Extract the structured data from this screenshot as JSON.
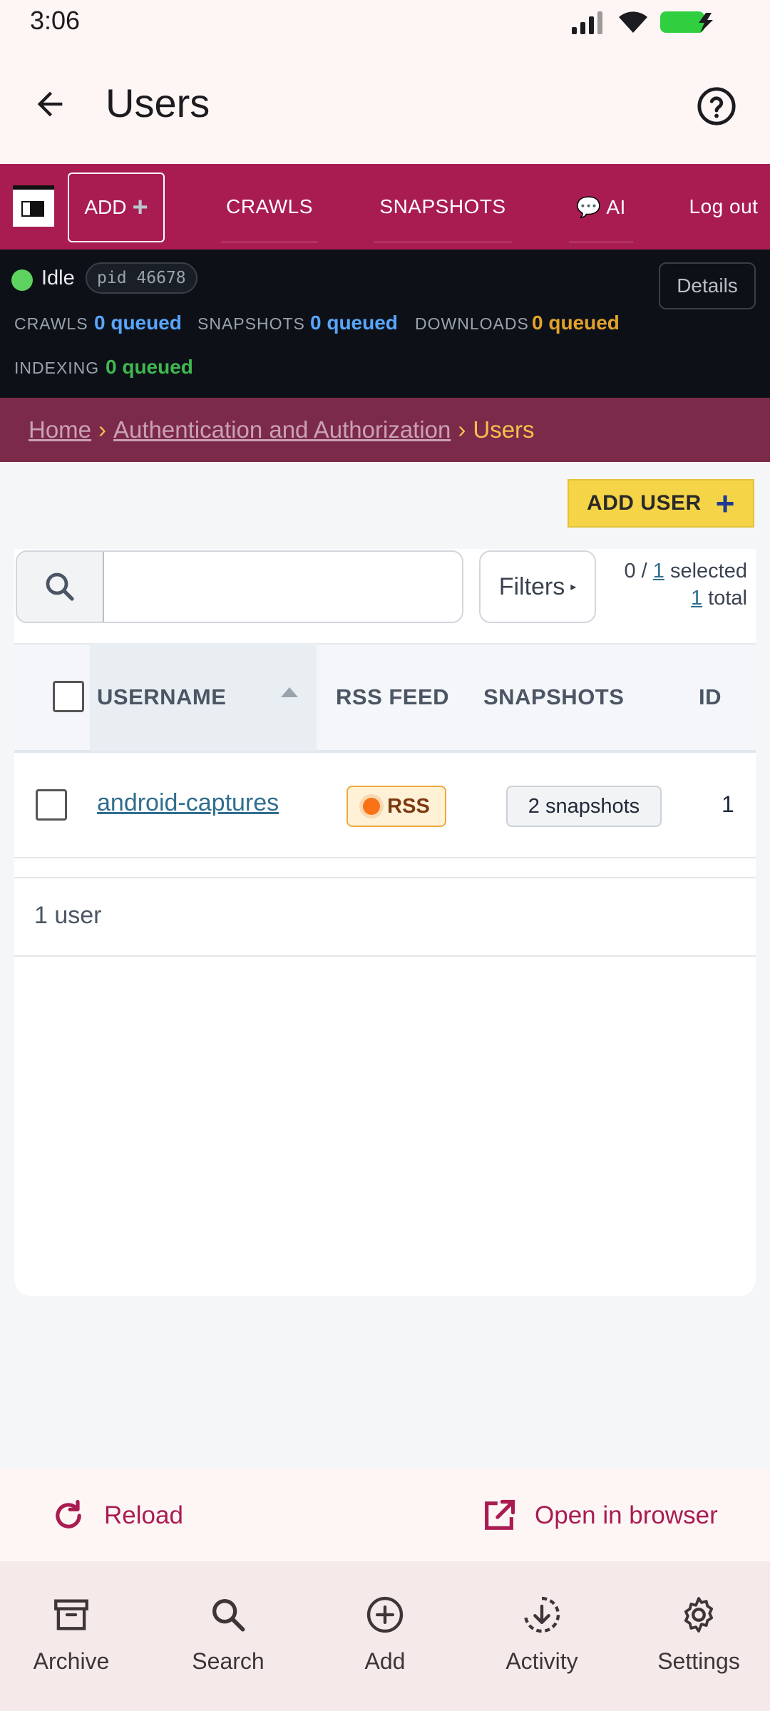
{
  "status_bar": {
    "time": "3:06"
  },
  "app_bar": {
    "title": "Users"
  },
  "web_nav": {
    "add_label": "ADD",
    "items": [
      "CRAWLS",
      "SNAPSHOTS",
      "💬 AI",
      "Log out"
    ]
  },
  "worker_status": {
    "state": "Idle",
    "pid": "pid 46678",
    "details_label": "Details",
    "queues": [
      {
        "label": "CRAWLS",
        "value": "0 queued",
        "color": "#58a6ff"
      },
      {
        "label": "SNAPSHOTS",
        "value": "0 queued",
        "color": "#58a6ff"
      },
      {
        "label": "DOWNLOADS",
        "value": "0 queued",
        "color": "#e3a32b"
      },
      {
        "label": "INDEXING",
        "value": "0 queued",
        "color": "#3fb950"
      }
    ]
  },
  "breadcrumb": {
    "home": "Home",
    "section": "Authentication and Authorization",
    "current": "Users",
    "separator": "›"
  },
  "toolbar": {
    "add_user_label": "ADD USER"
  },
  "search": {
    "placeholder": "",
    "value": ""
  },
  "filters": {
    "label": "Filters"
  },
  "selection": {
    "prefix": "0 / ",
    "selected_count": "1",
    "selected_suffix": " selected",
    "total_count": "1",
    "total_suffix": " total"
  },
  "table": {
    "columns": [
      "USERNAME",
      "RSS FEED",
      "SNAPSHOTS",
      "ID"
    ],
    "rows": [
      {
        "username": "android-captures",
        "rss": "RSS",
        "snapshots": "2 snapshots",
        "id": "1"
      }
    ],
    "count_text": "1 user"
  },
  "actions": {
    "reload": "Reload",
    "open_browser": "Open in browser"
  },
  "bottom_nav": [
    {
      "label": "Archive",
      "icon": "archive-icon"
    },
    {
      "label": "Search",
      "icon": "search-icon"
    },
    {
      "label": "Add",
      "icon": "add-circle-icon"
    },
    {
      "label": "Activity",
      "icon": "activity-download-icon"
    },
    {
      "label": "Settings",
      "icon": "gear-icon"
    }
  ],
  "colors": {
    "brand": "#a91c52",
    "breadcrumb_bg": "#7c2a4a",
    "accent_yellow": "#f5d547"
  }
}
